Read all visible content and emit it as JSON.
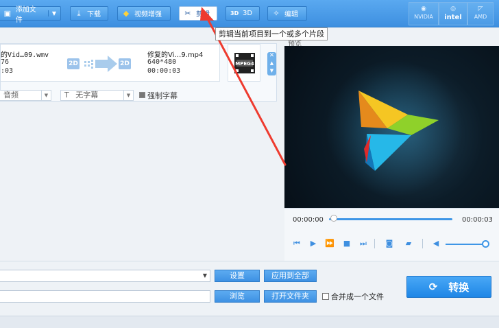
{
  "toolbar": {
    "add_file": "添加文件",
    "download": "下载",
    "video_enhance": "视频增强",
    "clip": "剪辑",
    "three_d": "3D",
    "watermark": "编辑",
    "hw_nvidia": "NVIDIA",
    "hw_intel": "intel",
    "hw_amd": "AMD"
  },
  "tooltip": "剪辑当前项目到一个或多个片段",
  "file_item": {
    "source_name": "的Vid…09.wmv",
    "source_res": "76",
    "source_dur": ":03",
    "src_badge": "2D",
    "dst_badge": "2D",
    "output_name": "修复的Vi…9.mp4",
    "output_res": "640*480",
    "output_dur": "00:00:03",
    "format_label": "MPEG4",
    "audio_select": "音频",
    "subtitle_select": "无字幕",
    "force_subtitle": "强制字幕"
  },
  "preview": {
    "title": "预览",
    "time_current": "00:00:00",
    "time_total": "00:00:03",
    "seek_progress": 0.0,
    "volume_level": 0.9
  },
  "bottom": {
    "settings_button": "设置",
    "apply_all_button": "应用到全部",
    "browse_button": "浏览",
    "open_folder_button": "打开文件夹",
    "merge_label": "合并成一个文件",
    "convert_button": "转换"
  },
  "colors": {
    "accent": "#3d8fe0",
    "arrow": "#ee3b2f"
  }
}
